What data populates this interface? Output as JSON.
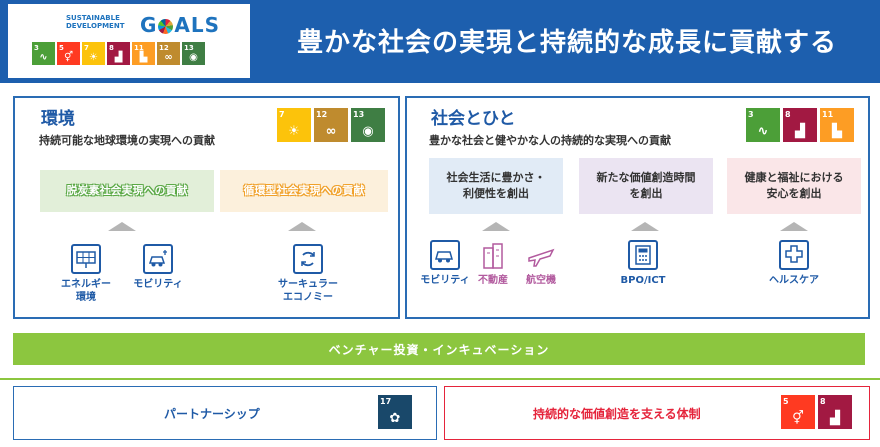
{
  "header": {
    "logo_line1": "SUSTAINABLE",
    "logo_line2": "DEVELOPMENT",
    "logo_goals_left": "G",
    "logo_goals_right": "ALS",
    "title": "豊かな社会の実現と持続的な成長に貢献する",
    "sdg_tiles": [
      {
        "num": "3",
        "color": "#4c9f38",
        "icon": "heartbeat-icon",
        "glyph": "∿"
      },
      {
        "num": "5",
        "color": "#ff3a21",
        "icon": "gender-icon",
        "glyph": "⚥"
      },
      {
        "num": "7",
        "color": "#fcc30b",
        "icon": "sun-icon",
        "glyph": "☀"
      },
      {
        "num": "8",
        "color": "#a21942",
        "icon": "growth-chart-icon",
        "glyph": "▟"
      },
      {
        "num": "11",
        "color": "#fd9d24",
        "icon": "city-icon",
        "glyph": "▙"
      },
      {
        "num": "12",
        "color": "#bf8b2e",
        "icon": "infinity-icon",
        "glyph": "∞"
      },
      {
        "num": "13",
        "color": "#3f7e44",
        "icon": "eye-globe-icon",
        "glyph": "◉"
      }
    ]
  },
  "left_panel": {
    "title": "環境",
    "subtitle": "持続可能な地球環境の実現への貢献",
    "goals": [
      {
        "num": "7",
        "color": "#fcc30b",
        "icon": "sun-icon",
        "glyph": "☀"
      },
      {
        "num": "12",
        "color": "#bf8b2e",
        "icon": "infinity-icon",
        "glyph": "∞"
      },
      {
        "num": "13",
        "color": "#3f7e44",
        "icon": "eye-globe-icon",
        "glyph": "◉"
      }
    ],
    "boxes": [
      "脱炭素社会実現への貢献",
      "循環型社会実現への貢献"
    ],
    "sectors": [
      {
        "label": "エネルギー\n環境",
        "icon": "solar-panel-icon"
      },
      {
        "label": "モビリティ",
        "icon": "car-charging-icon"
      },
      {
        "label": "サーキュラー\nエコノミー",
        "icon": "recycle-icon"
      }
    ]
  },
  "right_panel": {
    "title": "社会とひと",
    "subtitle": "豊かな社会と健やかな人の持続的な実現への貢献",
    "goals": [
      {
        "num": "3",
        "color": "#4c9f38",
        "icon": "heartbeat-icon",
        "glyph": "∿"
      },
      {
        "num": "8",
        "color": "#a21942",
        "icon": "growth-chart-icon",
        "glyph": "▟"
      },
      {
        "num": "11",
        "color": "#fd9d24",
        "icon": "city-icon",
        "glyph": "▙"
      }
    ],
    "boxes": [
      "社会生活に豊かさ・\n利便性を創出",
      "新たな価値創造時間\nを創出",
      "健康と福祉における\n安心を創出"
    ],
    "sectors": [
      {
        "label": "モビリティ",
        "icon": "car-icon"
      },
      {
        "label": "不動産",
        "icon": "building-icon"
      },
      {
        "label": "航空機",
        "icon": "airplane-icon"
      },
      {
        "label": "BPO/ICT",
        "icon": "calculator-icon"
      },
      {
        "label": "ヘルスケア",
        "icon": "medical-cross-icon"
      }
    ]
  },
  "venture_bar": "ベンチャー投資・インキュベーション",
  "bottom": {
    "partnership": "パートナーシップ",
    "partnership_goal": {
      "num": "17",
      "color": "#19486a",
      "icon": "partnership-flower-icon",
      "glyph": "✿"
    },
    "support": "持続的な価値創造を支える体制",
    "support_goals": [
      {
        "num": "5",
        "color": "#ff3a21",
        "icon": "gender-icon",
        "glyph": "⚥"
      },
      {
        "num": "8",
        "color": "#a21942",
        "icon": "growth-chart-icon",
        "glyph": "▟"
      }
    ],
    "support_color": "#e5243b"
  },
  "colors": {
    "brand_blue": "#1d5fae",
    "venture_green": "#8cc63f"
  }
}
